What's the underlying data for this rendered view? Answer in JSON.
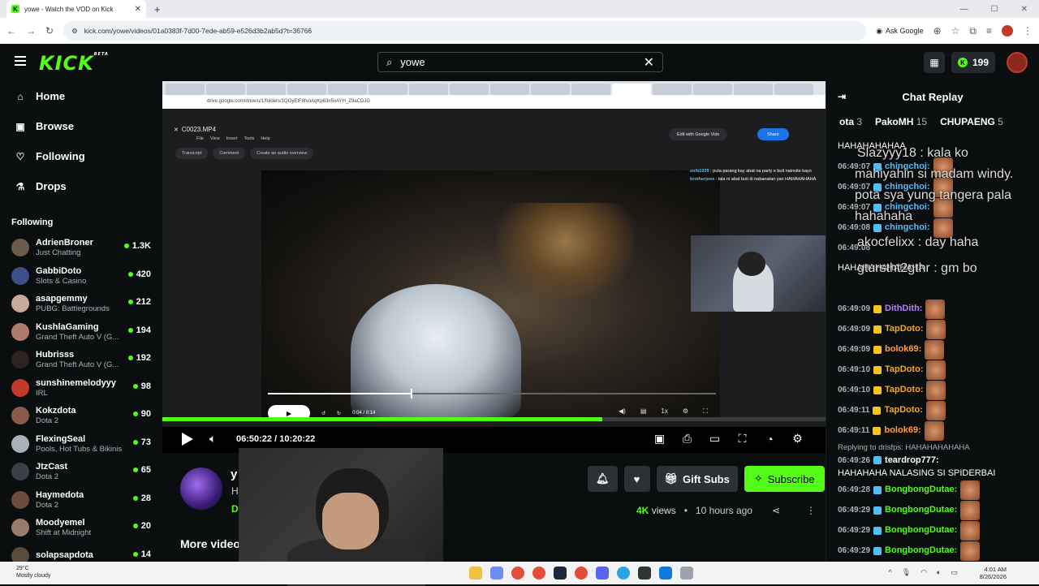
{
  "browser": {
    "tab_title": "yowe - Watch the VOD on Kick",
    "url": "kick.com/yowe/videos/01a0383f-7d00-7ede-ab59-e526d3b2ab5d?t=36766",
    "ask_label": "Ask Google"
  },
  "header": {
    "logo": "KICK",
    "logo_badge": "BETA",
    "search_value": "yowe",
    "coins": "199"
  },
  "sidebar": {
    "nav": [
      {
        "label": "Home",
        "icon": "home-icon"
      },
      {
        "label": "Browse",
        "icon": "browse-icon"
      },
      {
        "label": "Following",
        "icon": "heart-icon"
      },
      {
        "label": "Drops",
        "icon": "drops-icon"
      }
    ],
    "following_title": "Following",
    "channels": [
      {
        "name": "AdrienBroner",
        "category": "Just Chatting",
        "viewers": "1.3K"
      },
      {
        "name": "GabbiDoto",
        "category": "Slots & Casino",
        "viewers": "420"
      },
      {
        "name": "asapgemmy",
        "category": "PUBG: Battlegrounds",
        "viewers": "212"
      },
      {
        "name": "KushlaGaming",
        "category": "Grand Theft Auto V (G...",
        "viewers": "194"
      },
      {
        "name": "Hubrisss",
        "category": "Grand Theft Auto V (G...",
        "viewers": "192"
      },
      {
        "name": "sunshinemelodyyy",
        "category": "IRL",
        "viewers": "98"
      },
      {
        "name": "Kokzdota",
        "category": "Dota 2",
        "viewers": "90"
      },
      {
        "name": "FlexingSeal",
        "category": "Pools, Hot Tubs & Bikinis",
        "viewers": "73"
      },
      {
        "name": "JtzCast",
        "category": "Dota 2",
        "viewers": "65"
      },
      {
        "name": "Haymedota",
        "category": "Dota 2",
        "viewers": "28"
      },
      {
        "name": "Moodyemel",
        "category": "Shift at Midnight",
        "viewers": "20"
      },
      {
        "name": "solapsapdota",
        "category": "",
        "viewers": "14"
      }
    ]
  },
  "player": {
    "inner": {
      "url": "drive.google.com/drive/u/1/folders/1QGyEtF8fvoAqKp63n5vAYH_Z9aCDJG",
      "file_name": "C0023.MP4",
      "menu": [
        "File",
        "View",
        "Insert",
        "Tools",
        "Help"
      ],
      "tools": [
        "Transcript",
        "Comment",
        "Create an audio overview"
      ],
      "open_with": "Edit with Google Vids",
      "share": "Share",
      "chat": [
        {
          "user": "snib1029",
          "text": "puta parang kay abat na party e buti nainvite kayo"
        },
        {
          "user": "brotherjoee",
          "text": "lala ni abat buti di nabanatan yan HAHAHAHAHA"
        }
      ],
      "time": "0:04 / 0:14",
      "speed": "1x",
      "progress": 0.32
    },
    "progress": 0.663,
    "current_time": "06:50:22",
    "separator": "/",
    "duration": "10:20:22"
  },
  "below": {
    "streamer_initial": "y",
    "line2": "H",
    "line3": "D",
    "gift_label": "Gift Subs",
    "subscribe_label": "Subscribe",
    "views": "4K",
    "views_label": "views",
    "dot": "•",
    "ago": "10 hours ago",
    "more_videos": "More video"
  },
  "chat": {
    "title": "Chat Replay",
    "leaders": [
      {
        "name": "ota",
        "count": "3"
      },
      {
        "name": "PakoMH",
        "count": "15"
      },
      {
        "name": "CHUPAENG",
        "count": "5"
      }
    ],
    "messages": [
      {
        "time": "",
        "user": "",
        "text": "HAHAHAHAHAA",
        "emote": false
      },
      {
        "time": "06:49:07",
        "user": "chingchoi:",
        "text": "",
        "emote": true
      },
      {
        "time": "06:49:07",
        "user": "chingchoi:",
        "text": "",
        "emote": true
      },
      {
        "time": "06:49:07",
        "user": "chingchoi:",
        "text": "",
        "emote": true
      },
      {
        "time": "06:49:08",
        "user": "chingchoi:",
        "text": "",
        "emote": true
      },
      {
        "time": "06:49:08",
        "user": "",
        "text": "",
        "emote": false
      },
      {
        "time": "",
        "user": "",
        "text": "HAHAHAHAHAHAHA",
        "emote": false
      },
      {
        "time": "",
        "user": "",
        "text": "",
        "emote": false
      },
      {
        "time": "06:49:09",
        "user": "DithDith:",
        "text": "",
        "emote": true
      },
      {
        "time": "06:49:09",
        "user": "TapDoto:",
        "text": "",
        "emote": true
      },
      {
        "time": "06:49:09",
        "user": "bolok69:",
        "text": "",
        "emote": true
      },
      {
        "time": "06:49:10",
        "user": "TapDoto:",
        "text": "",
        "emote": true
      },
      {
        "time": "06:49:10",
        "user": "TapDoto:",
        "text": "",
        "emote": true
      },
      {
        "time": "06:49:11",
        "user": "TapDoto:",
        "text": "",
        "emote": true
      },
      {
        "time": "06:49:11",
        "user": "bolok69:",
        "text": "",
        "emote": true
      }
    ],
    "reply_line": "Replying to drisfps: HAHAHAHAHAHA",
    "reply_time": "06:49:26",
    "reply_user": "teardrop777:",
    "reply_text": "HAHAHAHA NALASING SI SPIDERBAI",
    "tail": [
      {
        "time": "06:49:28",
        "user": "BongbongDutae:"
      },
      {
        "time": "06:49:29",
        "user": "BongbongDutae:"
      },
      {
        "time": "06:49:29",
        "user": "BongbongDutae:"
      },
      {
        "time": "06:49:29",
        "user": "BongbongDutae:"
      },
      {
        "time": "06:49:29",
        "user": "BongbongDutae:"
      }
    ],
    "overlays": [
      "Slazyyy18 : kala ko",
      "mahiyahin si madam windy.",
      "pota sya yung tangera pala",
      "hahahaha",
      "akocfelixx : day haha",
      "gturstht2gthr : gm bo"
    ]
  },
  "taskbar": {
    "temp": "29°C",
    "weather": "Mostly cloudy",
    "time": "4:01 AM",
    "date": "8/26/2026"
  }
}
